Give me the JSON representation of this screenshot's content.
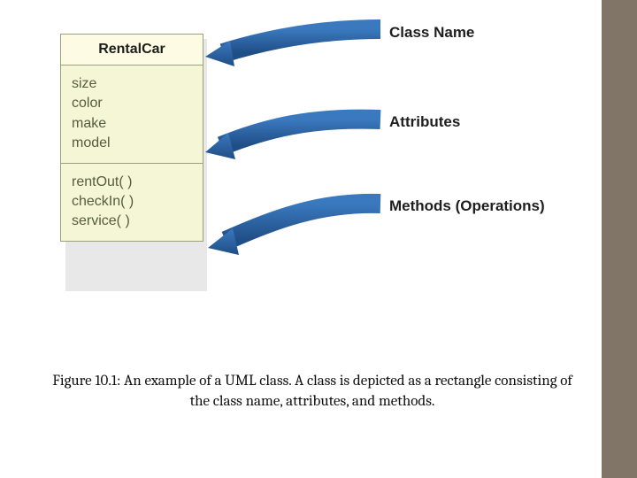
{
  "uml": {
    "className": "RentalCar",
    "attributes": [
      "size",
      "color",
      "make",
      "model"
    ],
    "methods": [
      "rentOut( )",
      "checkIn( )",
      "service( )"
    ]
  },
  "labels": {
    "classNameLabel": "Class Name",
    "attributesLabel": "Attributes",
    "methodsLabel": "Methods (Operations)"
  },
  "caption": "Figure 10.1: An example of a UML class. A class is depicted as a rectangle consisting of the class name, attributes, and methods.",
  "colors": {
    "arrow": "#295E9E",
    "stripe": "#817567",
    "umlBody": "#f5f6d6",
    "umlHeader": "#fdfbe3",
    "umlBorder": "#9aa17a"
  }
}
